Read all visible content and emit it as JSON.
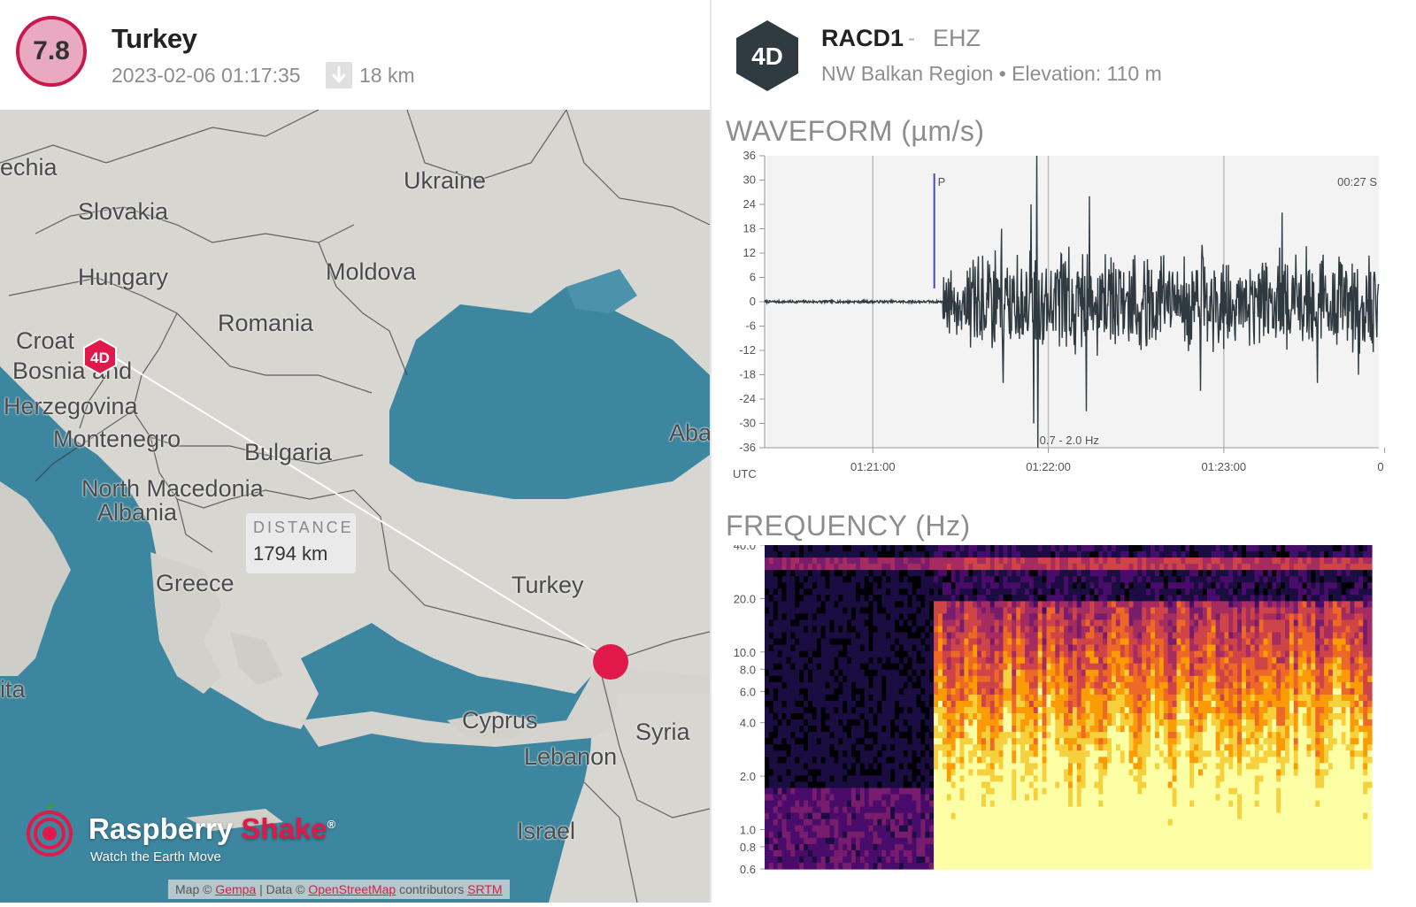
{
  "earthquake": {
    "magnitude": "7.8",
    "region": "Turkey",
    "datetime": "2023-02-06 01:17:35",
    "depth": "18 km",
    "depth_icon": "arrow-down-icon"
  },
  "map": {
    "labels": [
      "echia",
      "Slovakia",
      "Ukraine",
      "Hungary",
      "Moldova",
      "Romania",
      "Croat",
      "Bosnia and",
      "Herzegovina",
      "Montenegro",
      "Bulgaria",
      "North Macedonia",
      "Albania",
      "Greece",
      "Turkey",
      "Cyprus",
      "Syria",
      "Lebanon",
      "Israel",
      "Aba",
      "ita"
    ],
    "distance_label": "DISTANCE",
    "distance_value": "1794 km",
    "station_marker": "4D",
    "logo_name_1": "Raspberry ",
    "logo_name_2": "Shake",
    "logo_reg": "®",
    "logo_tagline": "Watch the Earth Move",
    "attribution": {
      "p1": "Map © ",
      "l1": "Gempa",
      "p2": " | Data © ",
      "l2": "OpenStreetMap",
      "p3": " contributors ",
      "l3": "SRTM"
    },
    "colors": {
      "land": "#d7d5d0",
      "sea": "#3a8199",
      "border": "#3a3a3a",
      "epicenter": "#e0194a"
    }
  },
  "station": {
    "network": "4D",
    "code": "RACD1",
    "separator": "-",
    "channel": "EHZ",
    "region": "NW Balkan Region",
    "bullet": "•",
    "elevation": "Elevation: 110 m"
  },
  "waveform": {
    "title": "WAVEFORM (µm/s)",
    "utc_label": "UTC",
    "p_label": "P",
    "s_label": "00:27  S",
    "filter_label": "0.7 - 2.0 Hz"
  },
  "frequency": {
    "title": "FREQUENCY (Hz)"
  },
  "chart_data": [
    {
      "type": "line",
      "title": "WAVEFORM (µm/s)",
      "xlabel": "UTC",
      "ylabel": "",
      "ylim": [
        -36,
        36
      ],
      "y_ticks": [
        "36",
        "30",
        "24",
        "18",
        "12",
        "6",
        "0",
        "-6",
        "-12",
        "-18",
        "-24",
        "-30",
        "-36"
      ],
      "x_ticks": [
        "01:21:00",
        "01:22:00",
        "01:23:00",
        "0"
      ],
      "x_tick_times_s": [
        0,
        60,
        120,
        175
      ],
      "x_range_s": [
        -37,
        173
      ],
      "p_arrival_s": 21,
      "s_arrival_s": 173,
      "noise_amplitude": 0.6,
      "onset_s": 24,
      "onset_amplitude": 8,
      "shaking_peaks": [
        {
          "t_s": 56,
          "value": 36
        },
        {
          "t_s": 56.5,
          "value": -36
        },
        {
          "t_s": 55,
          "value": -30
        },
        {
          "t_s": 54,
          "value": 24
        },
        {
          "t_s": 44,
          "value": 18
        },
        {
          "t_s": 44.5,
          "value": -20
        },
        {
          "t_s": 74,
          "value": 26
        },
        {
          "t_s": 73,
          "value": -27
        },
        {
          "t_s": 112,
          "value": -22
        },
        {
          "t_s": 112.5,
          "value": 14
        },
        {
          "t_s": 140,
          "value": 22
        },
        {
          "t_s": 152,
          "value": -20
        },
        {
          "t_s": 166,
          "value": -18
        }
      ],
      "series": [
        {
          "color": "#2e3a40"
        }
      ]
    },
    {
      "type": "heatmap",
      "title": "FREQUENCY (Hz)",
      "y_ticks": [
        "40.0",
        "20.0",
        "10.0",
        "8.0",
        "6.0",
        "4.0",
        "2.0",
        "1.0",
        "0.8",
        "0.6"
      ],
      "ylim": [
        0.6,
        40
      ],
      "y_scale": "log",
      "x_range_s": [
        -37,
        173
      ],
      "onset_s": 22,
      "colormap": "inferno",
      "colors": [
        "#000004",
        "#1b0c41",
        "#4a0c6b",
        "#781c6d",
        "#a52c60",
        "#cf4446",
        "#ed6925",
        "#fb9b06",
        "#f7d13d",
        "#fcffa4"
      ]
    }
  ]
}
